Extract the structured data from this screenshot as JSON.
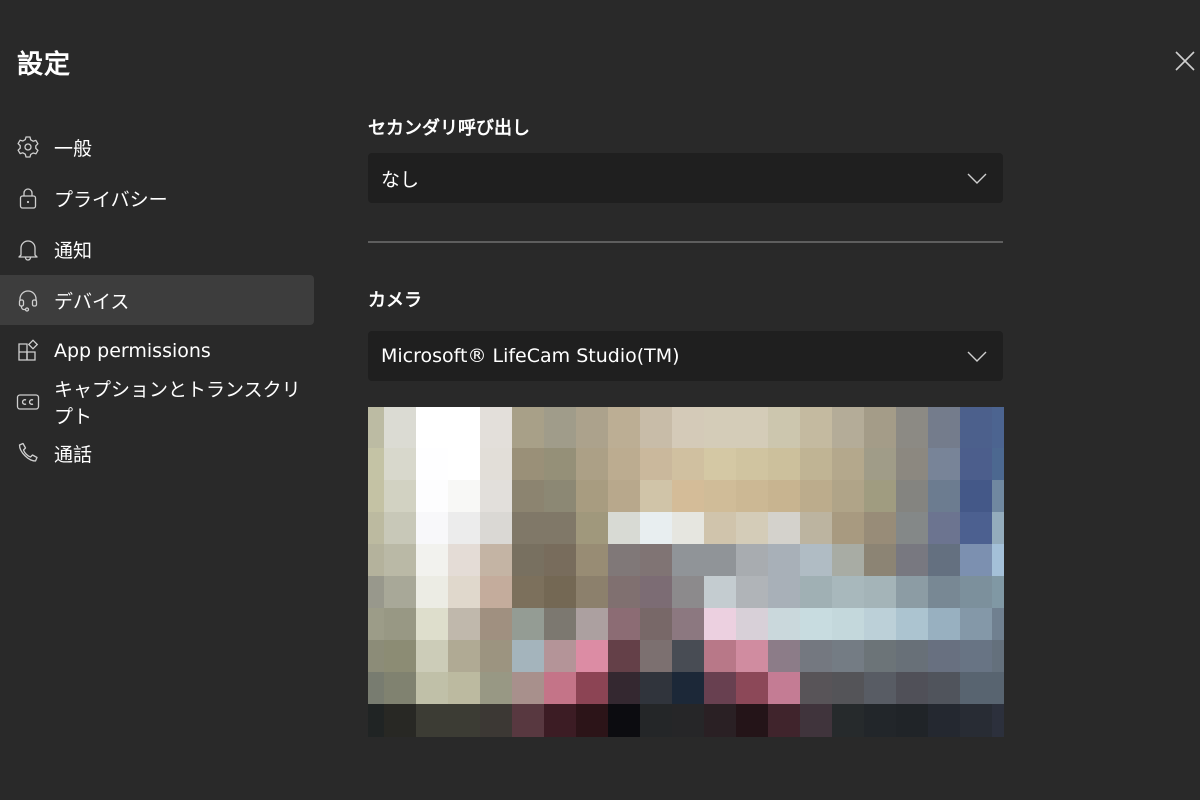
{
  "header": {
    "title": "設定",
    "close_label": "Close"
  },
  "sidebar": {
    "items": [
      {
        "label": "一般",
        "icon": "gear-icon",
        "selected": false
      },
      {
        "label": "プライバシー",
        "icon": "lock-icon",
        "selected": false
      },
      {
        "label": "通知",
        "icon": "bell-icon",
        "selected": false
      },
      {
        "label": "デバイス",
        "icon": "headset-icon",
        "selected": true
      },
      {
        "label": "App permissions",
        "icon": "apps-icon",
        "selected": false
      },
      {
        "label": "キャプションとトランスクリプト",
        "icon": "closed-captions-icon",
        "selected": false
      },
      {
        "label": "通話",
        "icon": "phone-icon",
        "selected": false
      }
    ]
  },
  "main": {
    "secondary_ringer": {
      "label": "セカンダリ呼び出し",
      "value": "なし"
    },
    "camera": {
      "label": "カメラ",
      "value": "Microsoft® LifeCam Studio(TM)",
      "preview_description": "Pixelated camera preview",
      "preview_mosaic": [
        [
          "#bcbba3",
          "#dbdbd3",
          "#ffffff",
          "#ffffff",
          "#e3dfda",
          "#a8a088",
          "#a09c8a",
          "#aca28c",
          "#bcae94",
          "#c8bca8",
          "#d4cab8",
          "#d4ccb8",
          "#d4ccb8",
          "#ccc6ae",
          "#c4baa0",
          "#b4ac98",
          "#a49c88",
          "#8c8a84",
          "#747c8c",
          "#4c608c",
          "#4c6490"
        ],
        [
          "#c4c3a5",
          "#d8d8cc",
          "#fefeff",
          "#ffffff",
          "#e2ded8",
          "#9a9078",
          "#959078",
          "#aca086",
          "#bcac90",
          "#cab89c",
          "#d0c0a0",
          "#d4c8a4",
          "#d0c4a0",
          "#ccc09c",
          "#c0b494",
          "#b4a88c",
          "#a09c88",
          "#8c8880",
          "#788498",
          "#4c5e8c",
          "#4c6890"
        ],
        [
          "#c4c2a4",
          "#d2d2c2",
          "#fdfdfe",
          "#f8f8f6",
          "#e2dfdb",
          "#8c8470",
          "#8c8874",
          "#a89c80",
          "#b8a88c",
          "#d0c4a8",
          "#d4bc98",
          "#d0bc98",
          "#ccb894",
          "#c8b490",
          "#bcac8c",
          "#b0a488",
          "#a09c80",
          "#848480",
          "#6c7c90",
          "#445888",
          "#7088a0"
        ],
        [
          "#bcbaa0",
          "#c8c8b8",
          "#f8f8fa",
          "#ececec",
          "#dad8d4",
          "#807868",
          "#807868",
          "#a0987c",
          "#d8dad4",
          "#e8eef0",
          "#e6e6e0",
          "#d0c4ac",
          "#d4ccb8",
          "#d4d2cc",
          "#bcb4a0",
          "#a89a80",
          "#988c78",
          "#848888",
          "#6c7490",
          "#4c6090",
          "#94acbc"
        ],
        [
          "#b4b29c",
          "#bab9a6",
          "#f2f2ee",
          "#e4dcd6",
          "#c4b4a4",
          "#787060",
          "#786c5c",
          "#988c74",
          "#807878",
          "#807474",
          "#909498",
          "#909498",
          "#a8acb0",
          "#a8b0b8",
          "#b0bcc4",
          "#a8aca4",
          "#8c8474",
          "#787880",
          "#647080",
          "#7c90b0",
          "#a4c0d8"
        ],
        [
          "#98988c",
          "#a8a898",
          "#ecece4",
          "#e0d8cc",
          "#c4ac9c",
          "#7c705c",
          "#746854",
          "#8c806c",
          "#807070",
          "#7c6c74",
          "#8c8a8c",
          "#c4ccd0",
          "#b0b4b8",
          "#a8b0b8",
          "#a0b0b4",
          "#a8b8bc",
          "#a4b4b8",
          "#8c9ca4",
          "#788894",
          "#7c909c",
          "#8098a4"
        ],
        [
          "#9c9c88",
          "#989884",
          "#dedecc",
          "#c0b8ac",
          "#a09080",
          "#949c94",
          "#7c7870",
          "#aca0a0",
          "#8c6c74",
          "#786868",
          "#8c7880",
          "#ecd0e0",
          "#d8d0d8",
          "#cad8dc",
          "#c8dce0",
          "#c4d8dc",
          "#bcd0d8",
          "#acc4d0",
          "#98b0c0",
          "#8498a8",
          "#708090"
        ],
        [
          "#8c8c78",
          "#8c8c74",
          "#ccccb8",
          "#b0aa94",
          "#9c9480",
          "#a4b4bc",
          "#b49498",
          "#dc8ca4",
          "#644048",
          "#7c7070",
          "#484c54",
          "#b87888",
          "#d08ca0",
          "#8c7c88",
          "#747880",
          "#747c84",
          "#6c7478",
          "#687078",
          "#687080",
          "#687484",
          "#64707c"
        ],
        [
          "#787c70",
          "#808270",
          "#c0c0a8",
          "#bcbaa0",
          "#989884",
          "#a8908c",
          "#c47488",
          "#8c4454",
          "#342830",
          "#30343c",
          "#1c2838",
          "#684050",
          "#8c4858",
          "#c47c94",
          "#585458",
          "#545458",
          "#585c64",
          "#505058",
          "#50545c",
          "#586470",
          "#586470"
        ],
        [
          "#202424",
          "#282824",
          "#3c3c34",
          "#3c3c34",
          "#3c3834",
          "#583840",
          "#3c1c24",
          "#2c1418",
          "#0c0c10",
          "#242628",
          "#262628",
          "#2a2024",
          "#241418",
          "#40242c",
          "#40343c",
          "#262a2c",
          "#22262a",
          "#202428",
          "#242830",
          "#282c34",
          "#2c303c"
        ]
      ]
    }
  }
}
